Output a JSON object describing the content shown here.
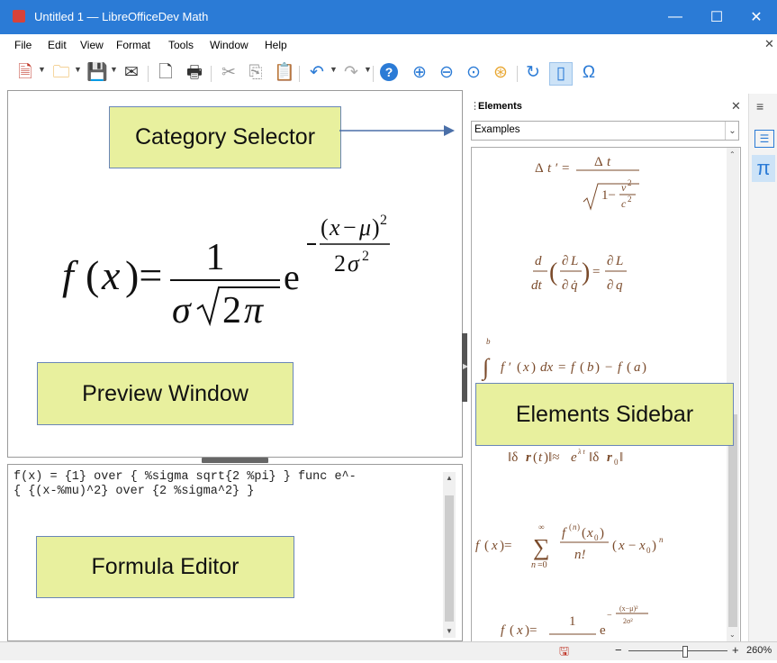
{
  "window": {
    "title": "Untitled 1 — LibreOfficeDev Math",
    "minimize": "—",
    "maximize": "☐",
    "close": "✕",
    "doc_close": "✕"
  },
  "menu": [
    "File",
    "Edit",
    "View",
    "Format",
    "Tools",
    "Window",
    "Help"
  ],
  "toolbar_icons": [
    "new-document-icon",
    "open-folder-icon",
    "save-icon",
    "email-icon",
    "export-pdf-icon",
    "print-icon",
    "cut-icon",
    "copy-icon",
    "paste-icon",
    "undo-icon",
    "redo-icon",
    "help-icon",
    "zoom-in-icon",
    "zoom-out-icon",
    "zoom-100-icon",
    "show-all-icon",
    "update-icon",
    "formula-cursor-icon",
    "symbols-icon"
  ],
  "editor": {
    "line1": "f(x) = {1} over { %sigma sqrt{2 %pi} } func e^-",
    "line2": "{ {(x-%mu)^2} over {2 %sigma^2} }"
  },
  "sidebar": {
    "title": "Elements",
    "close": "✕",
    "menu": "≡",
    "category": "Examples"
  },
  "callouts": {
    "category_selector": "Category Selector",
    "preview_window": "Preview Window",
    "elements_sidebar": "Elements Sidebar",
    "formula_editor": "Formula Editor"
  },
  "status": {
    "zoom": "260%",
    "minus": "−",
    "plus": "+"
  },
  "colors": {
    "titlebar": "#2b7bd6",
    "callout_fill": "#e8f09e",
    "callout_border": "#6a86b8",
    "example_formula": "#7a4a2a"
  }
}
